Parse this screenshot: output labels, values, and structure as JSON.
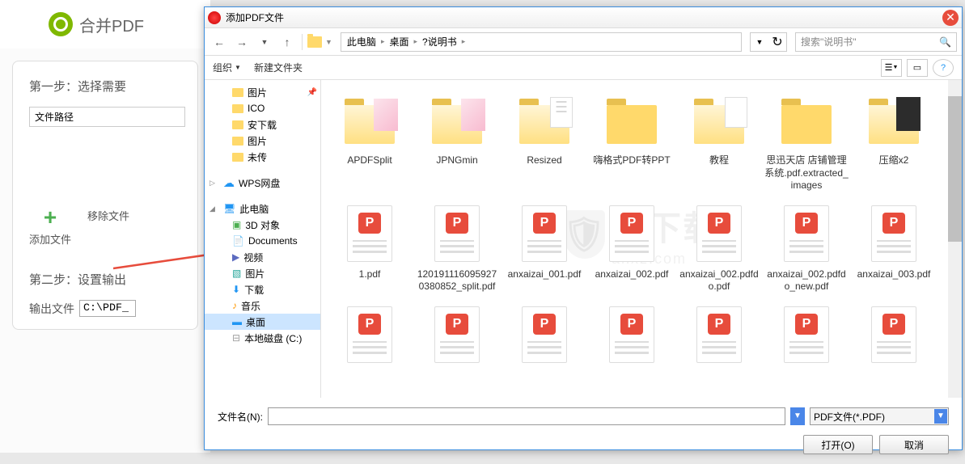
{
  "bg_app": {
    "title": "合并PDF",
    "step1": "第一步：选择需要",
    "col_path": "文件路径",
    "add_file": "添加文件",
    "remove_file": "移除文件",
    "step2": "第二步：设置输出",
    "output_label": "输出文件",
    "output_value": "C:\\PDF_"
  },
  "dialog": {
    "title": "添加PDF文件",
    "breadcrumb": [
      "此电脑",
      "桌面",
      "?说明书"
    ],
    "search_placeholder": "搜索\"说明书\"",
    "toolbar": {
      "organize": "组织",
      "new_folder": "新建文件夹"
    },
    "tree": [
      {
        "label": "图片",
        "type": "folder",
        "level": 2,
        "pin": true
      },
      {
        "label": "ICO",
        "type": "folder",
        "level": 2
      },
      {
        "label": "安下载",
        "type": "folder",
        "level": 2
      },
      {
        "label": "图片",
        "type": "folder",
        "level": 2
      },
      {
        "label": "未传",
        "type": "folder",
        "level": 2
      },
      {
        "label": "WPS网盘",
        "type": "cloud",
        "level": 1,
        "expand": ">"
      },
      {
        "label": "此电脑",
        "type": "pc",
        "level": 1,
        "expand": "v"
      },
      {
        "label": "3D 对象",
        "type": "3d",
        "level": 2
      },
      {
        "label": "Documents",
        "type": "doc",
        "level": 2
      },
      {
        "label": "视频",
        "type": "vid",
        "level": 2
      },
      {
        "label": "图片",
        "type": "pic",
        "level": 2
      },
      {
        "label": "下载",
        "type": "dl",
        "level": 2
      },
      {
        "label": "音乐",
        "type": "music",
        "level": 2
      },
      {
        "label": "桌面",
        "type": "desk",
        "level": 2,
        "selected": true
      },
      {
        "label": "本地磁盘 (C:)",
        "type": "disk",
        "level": 2
      }
    ],
    "files_row1": [
      {
        "name": "APDFSplit",
        "type": "folder",
        "inner": "pic"
      },
      {
        "name": "JPNGmin",
        "type": "folder",
        "inner": "pic"
      },
      {
        "name": "Resized",
        "type": "folder",
        "inner": "doc"
      },
      {
        "name": "嗨格式PDF转PPT",
        "type": "folder"
      },
      {
        "name": "教程",
        "type": "folder",
        "inner": "img"
      },
      {
        "name": "思迅天店 店铺管理系统.pdf.extracted_images",
        "type": "folder"
      },
      {
        "name": "压缩x2",
        "type": "folder",
        "inner": "dark"
      }
    ],
    "files_row2": [
      {
        "name": "1.pdf",
        "type": "pdf"
      },
      {
        "name": "1201911160959270380852_split.pdf",
        "type": "pdf"
      },
      {
        "name": "anxaizai_001.pdf",
        "type": "pdf"
      },
      {
        "name": "anxaizai_002.pdf",
        "type": "pdf"
      },
      {
        "name": "anxaizai_002.pdfdo.pdf",
        "type": "pdf"
      },
      {
        "name": "anxaizai_002.pdfdo_new.pdf",
        "type": "pdf"
      },
      {
        "name": "anxaizai_003.pdf",
        "type": "pdf"
      }
    ],
    "files_row3": [
      {
        "type": "pdf"
      },
      {
        "type": "pdf"
      },
      {
        "type": "pdf"
      },
      {
        "type": "pdf"
      },
      {
        "type": "pdf"
      },
      {
        "type": "pdf"
      },
      {
        "type": "pdf"
      }
    ],
    "watermark": "安下载",
    "watermark_sub": "anxz.com",
    "footer": {
      "filename_label": "文件名(N):",
      "filter": "PDF文件(*.PDF)",
      "open": "打开(O)",
      "cancel": "取消"
    }
  }
}
